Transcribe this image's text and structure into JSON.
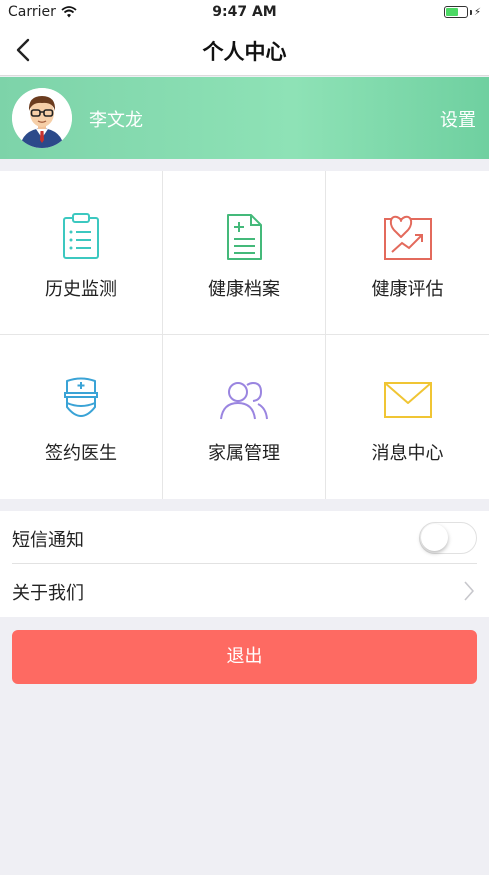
{
  "status_bar": {
    "carrier": "Carrier",
    "time": "9:47 AM",
    "battery_level": 0.6
  },
  "header": {
    "title": "个人中心"
  },
  "profile": {
    "name": "李文龙",
    "settings_label": "设置"
  },
  "menu": {
    "items": [
      {
        "label": "历史监测",
        "icon": "clipboard-list-icon",
        "color": "#3cc8c0"
      },
      {
        "label": "健康档案",
        "icon": "health-document-icon",
        "color": "#44b97a"
      },
      {
        "label": "健康评估",
        "icon": "heart-chart-icon",
        "color": "#e36a5c"
      },
      {
        "label": "签约医生",
        "icon": "doctor-icon",
        "color": "#3aa3d6"
      },
      {
        "label": "家属管理",
        "icon": "family-icon",
        "color": "#9a85e0"
      },
      {
        "label": "消息中心",
        "icon": "envelope-icon",
        "color": "#f0c534"
      }
    ]
  },
  "settings_list": {
    "sms_label": "短信通知",
    "sms_enabled": false,
    "about_label": "关于我们"
  },
  "logout_label": "退出",
  "colors": {
    "profile_green": "#8ee2b6",
    "logout_red": "#fe6a62"
  }
}
